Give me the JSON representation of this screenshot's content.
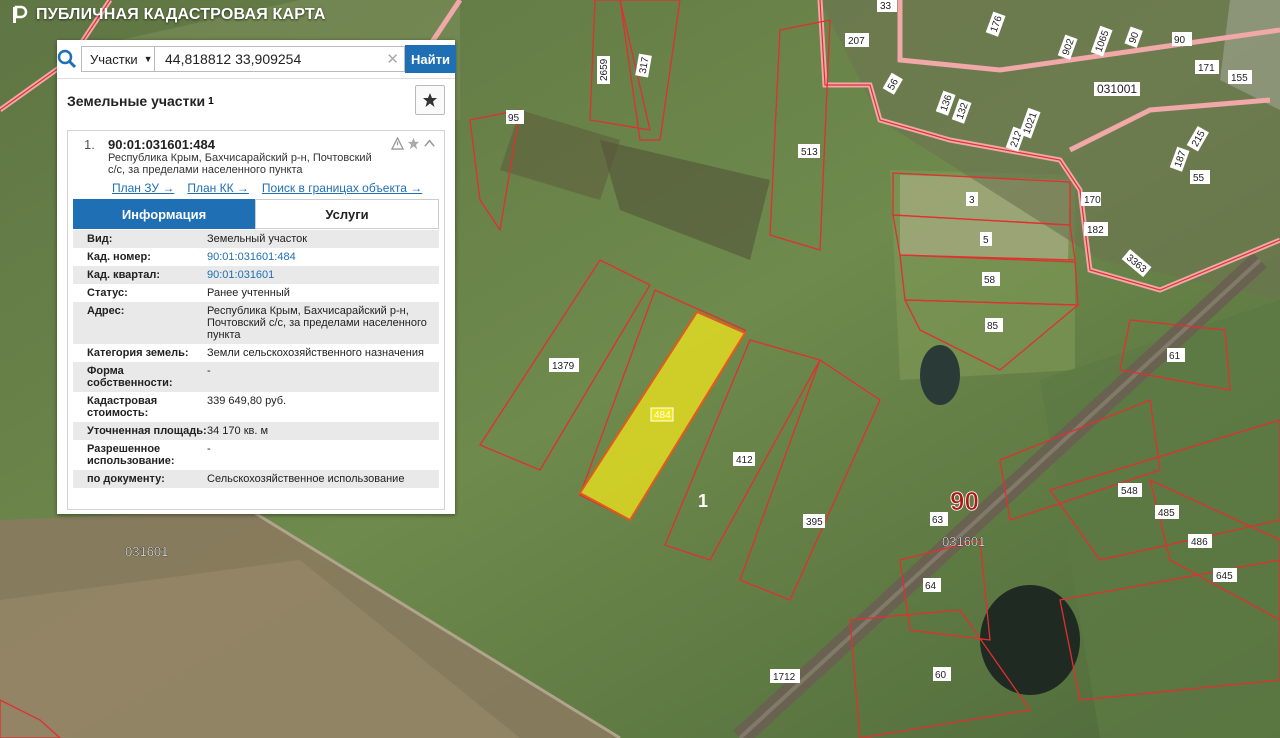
{
  "app": {
    "title": "ПУБЛИЧНАЯ КАДАСТРОВАЯ КАРТА"
  },
  "search": {
    "type_label": "Участки",
    "query": "44,818812 33,909254",
    "button_label": "Найти"
  },
  "panel": {
    "title": "Земельные участки",
    "count": "1"
  },
  "result": {
    "index": "1.",
    "number": "90:01:031601:484",
    "address": "Республика Крым, Бахчисарайский р-н, Почтовский с/с, за пределами населенного пункта",
    "links": [
      "План ЗУ →",
      "План КК →",
      "Поиск в границах объекта →"
    ],
    "tabs": [
      "Информация",
      "Услуги"
    ],
    "info": [
      {
        "k": "Вид:",
        "v": "Земельный участок"
      },
      {
        "k": "Кад. номер:",
        "v": "90:01:031601:484",
        "link": true
      },
      {
        "k": "Кад. квартал:",
        "v": "90:01:031601",
        "link": true
      },
      {
        "k": "Статус:",
        "v": "Ранее учтенный"
      },
      {
        "k": "Адрес:",
        "v": "Республика Крым, Бахчисарайский р-н, Почтовский с/с, за пределами населенного пункта"
      },
      {
        "k": "Категория земель:",
        "v": "Земли сельскохозяйственного назначения"
      },
      {
        "k": "Форма собственности:",
        "v": "-"
      },
      {
        "k": "Кадастровая стоимость:",
        "v": "339 649,80 руб."
      },
      {
        "k": "Уточненная площадь:",
        "v": "34 170 кв. м"
      },
      {
        "k": "Разрешенное использование:",
        "v": "-"
      },
      {
        "k": "по документу:",
        "v": "Сельскохозяйственное использование"
      }
    ]
  },
  "map": {
    "parcel_labels": [
      "484",
      "1379",
      "412",
      "395",
      "1",
      "95",
      "513",
      "3",
      "5",
      "58",
      "85",
      "61",
      "90",
      "63",
      "031601",
      "548",
      "485",
      "486",
      "645",
      "64",
      "60",
      "1712",
      "031601",
      "2659",
      "317",
      "207",
      "33",
      "56",
      "176",
      "136",
      "902",
      "90",
      "132",
      "111",
      "021",
      "212",
      "1065",
      "031001",
      "171",
      "155",
      "215",
      "187",
      "55",
      "170",
      "182",
      "3363"
    ],
    "colors": {
      "selected_fill": "#f0e61e",
      "boundary": "#e03030",
      "accent": "#1f6fb5"
    }
  }
}
